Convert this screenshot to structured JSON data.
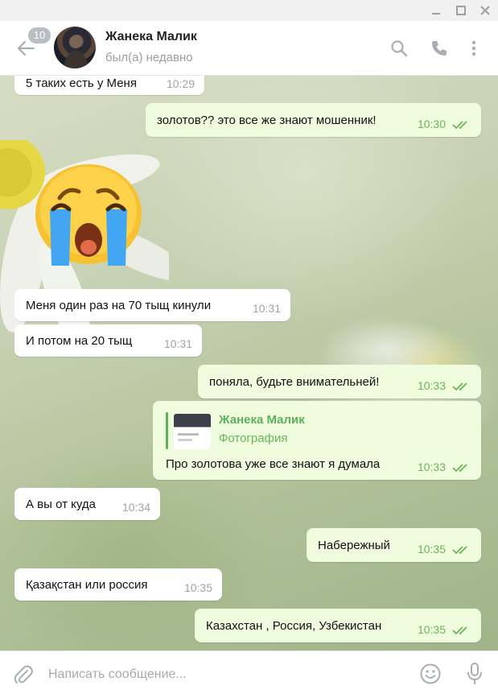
{
  "window": {
    "controls": [
      "minimize-icon",
      "maximize-icon",
      "close-icon"
    ]
  },
  "header": {
    "unread_badge": "10",
    "contact_name": "Жанека Малик",
    "contact_status": "был(а) недавно",
    "icons": [
      "back-arrow-icon",
      "search-icon",
      "phone-icon",
      "more-vertical-icon"
    ]
  },
  "messages": [
    {
      "id": "m1",
      "dir": "in",
      "text": "5 таких есть у Меня",
      "time": "10:29"
    },
    {
      "id": "m2",
      "dir": "out",
      "text": "золотов?? это все же знают мошенник!",
      "time": "10:30",
      "read": true
    },
    {
      "id": "m3",
      "dir": "in",
      "type": "sticker",
      "sticker": "crying-face-emoji"
    },
    {
      "id": "m4",
      "dir": "in",
      "text": "Меня один раз на 70 тыщ кинули",
      "time": "10:31"
    },
    {
      "id": "m5",
      "dir": "in",
      "text": "И потом на 20 тыщ",
      "time": "10:31"
    },
    {
      "id": "m6",
      "dir": "out",
      "text": "поняла, будьте внимательней!",
      "time": "10:33",
      "read": true
    },
    {
      "id": "m7",
      "dir": "out",
      "reply_to": {
        "name": "Жанека Малик",
        "subtitle": "Фотография"
      },
      "text": "Про золотова уже все знают я думала",
      "time": "10:33",
      "read": true
    },
    {
      "id": "m8",
      "dir": "in",
      "text": "А вы от куда",
      "time": "10:34"
    },
    {
      "id": "m9",
      "dir": "out",
      "text": "Набережный",
      "time": "10:35",
      "read": true
    },
    {
      "id": "m10",
      "dir": "in",
      "text": "Қазақстан или россия",
      "time": "10:35"
    },
    {
      "id": "m11",
      "dir": "out",
      "text": "Казахстан , Россия, Узбекистан",
      "time": "10:35",
      "read": true
    }
  ],
  "composer": {
    "placeholder": "Написать сообщение...",
    "value": "",
    "icons": [
      "attach-icon",
      "emoji-icon",
      "microphone-icon"
    ]
  },
  "colors": {
    "outgoing_bubble": "#effdde",
    "incoming_bubble": "#ffffff",
    "accent_green": "#5fb159",
    "time_gray": "#a0a4a8",
    "icon_gray": "#a9aeb3"
  }
}
